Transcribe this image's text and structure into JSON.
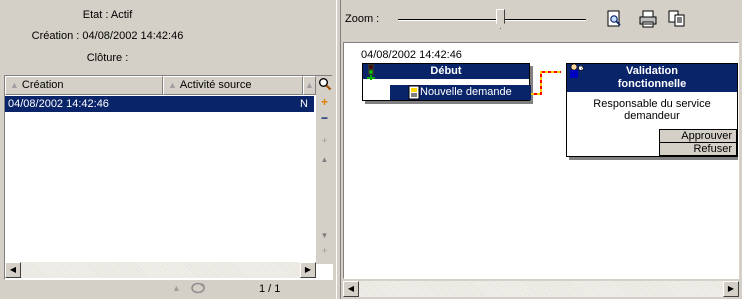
{
  "info": {
    "state": "Etat : Actif",
    "creation": "Création : 04/08/2002 14:42:46",
    "closure": "Clôture :"
  },
  "list": {
    "columns": [
      "Création",
      "Activité source",
      ""
    ],
    "rows": [
      {
        "creation": "04/08/2002 14:42:46",
        "source": "",
        "trunc": "N"
      }
    ],
    "pagination": "1 / 1"
  },
  "toolbar": {
    "zoom_label": "Zoom :",
    "zoom_level": 0.55
  },
  "canvas": {
    "timestamp": "04/08/2002 14:42:46",
    "start_node": {
      "title": "Début",
      "event": "Nouvelle demande"
    },
    "validation_node": {
      "title_line1": "Validation",
      "title_line2": "fonctionnelle",
      "assignee": "Responsable du service demandeur",
      "actions": [
        "Approuver",
        "Refuser"
      ]
    }
  },
  "colors": {
    "selection": "#0a246a",
    "link": "#ff0000",
    "link_alt": "#ffcc00"
  }
}
